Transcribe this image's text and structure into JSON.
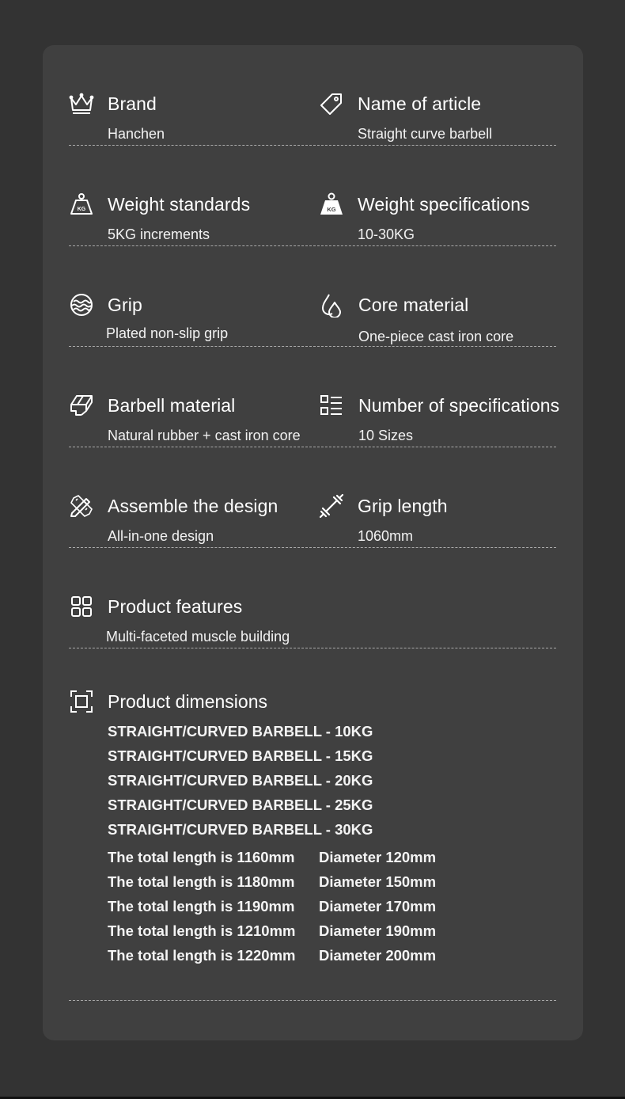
{
  "specs": {
    "brand": {
      "title": "Brand",
      "value": "Hanchen",
      "icon": "crown-icon"
    },
    "name_of_article": {
      "title": "Name of article",
      "value": "Straight curve barbell",
      "icon": "tag-icon"
    },
    "weight_standards": {
      "title": "Weight standards",
      "value": "5KG increments",
      "icon": "kg-weight-outline-icon"
    },
    "weight_specifications": {
      "title": "Weight specifications",
      "value": "10-30KG",
      "icon": "kg-weight-filled-icon"
    },
    "grip": {
      "title": "Grip",
      "value": "Plated non-slip grip",
      "icon": "wave-circle-icon"
    },
    "core_material": {
      "title": "Core material",
      "value": "One-piece cast iron core",
      "icon": "droplets-icon"
    },
    "barbell_material": {
      "title": "Barbell material",
      "value": "Natural rubber + cast iron core",
      "icon": "material-block-icon"
    },
    "number_of_specifications": {
      "title": "Number of specifications",
      "value": "10 Sizes",
      "icon": "list-icon"
    },
    "assemble_the_design": {
      "title": "Assemble the design",
      "value": "All-in-one design",
      "icon": "design-tools-icon"
    },
    "grip_length": {
      "title": "Grip length",
      "value": "1060mm",
      "icon": "dumbbell-icon"
    },
    "product_features": {
      "title": "Product features",
      "value": "Multi-faceted muscle building",
      "icon": "grid-icon"
    }
  },
  "dimensions": {
    "title": "Product dimensions",
    "icon": "frame-icon",
    "models": [
      "STRAIGHT/CURVED BARBELL - 10KG",
      "STRAIGHT/CURVED BARBELL - 15KG",
      "STRAIGHT/CURVED BARBELL - 20KG",
      "STRAIGHT/CURVED BARBELL - 25KG",
      "STRAIGHT/CURVED BARBELL - 30KG"
    ],
    "sizes": [
      {
        "length": "The total length is 1160mm",
        "diameter": "Diameter 120mm"
      },
      {
        "length": "The total length is 1180mm",
        "diameter": "Diameter 150mm"
      },
      {
        "length": "The total length is 1190mm",
        "diameter": "Diameter 170mm"
      },
      {
        "length": "The total length is 1210mm",
        "diameter": "Diameter 190mm"
      },
      {
        "length": "The total length is 1220mm",
        "diameter": "Diameter 200mm"
      }
    ]
  },
  "colors": {
    "page_bg": "#333333",
    "card_bg": "#404040",
    "text": "#ffffff",
    "separator": "#a9a9a9"
  }
}
